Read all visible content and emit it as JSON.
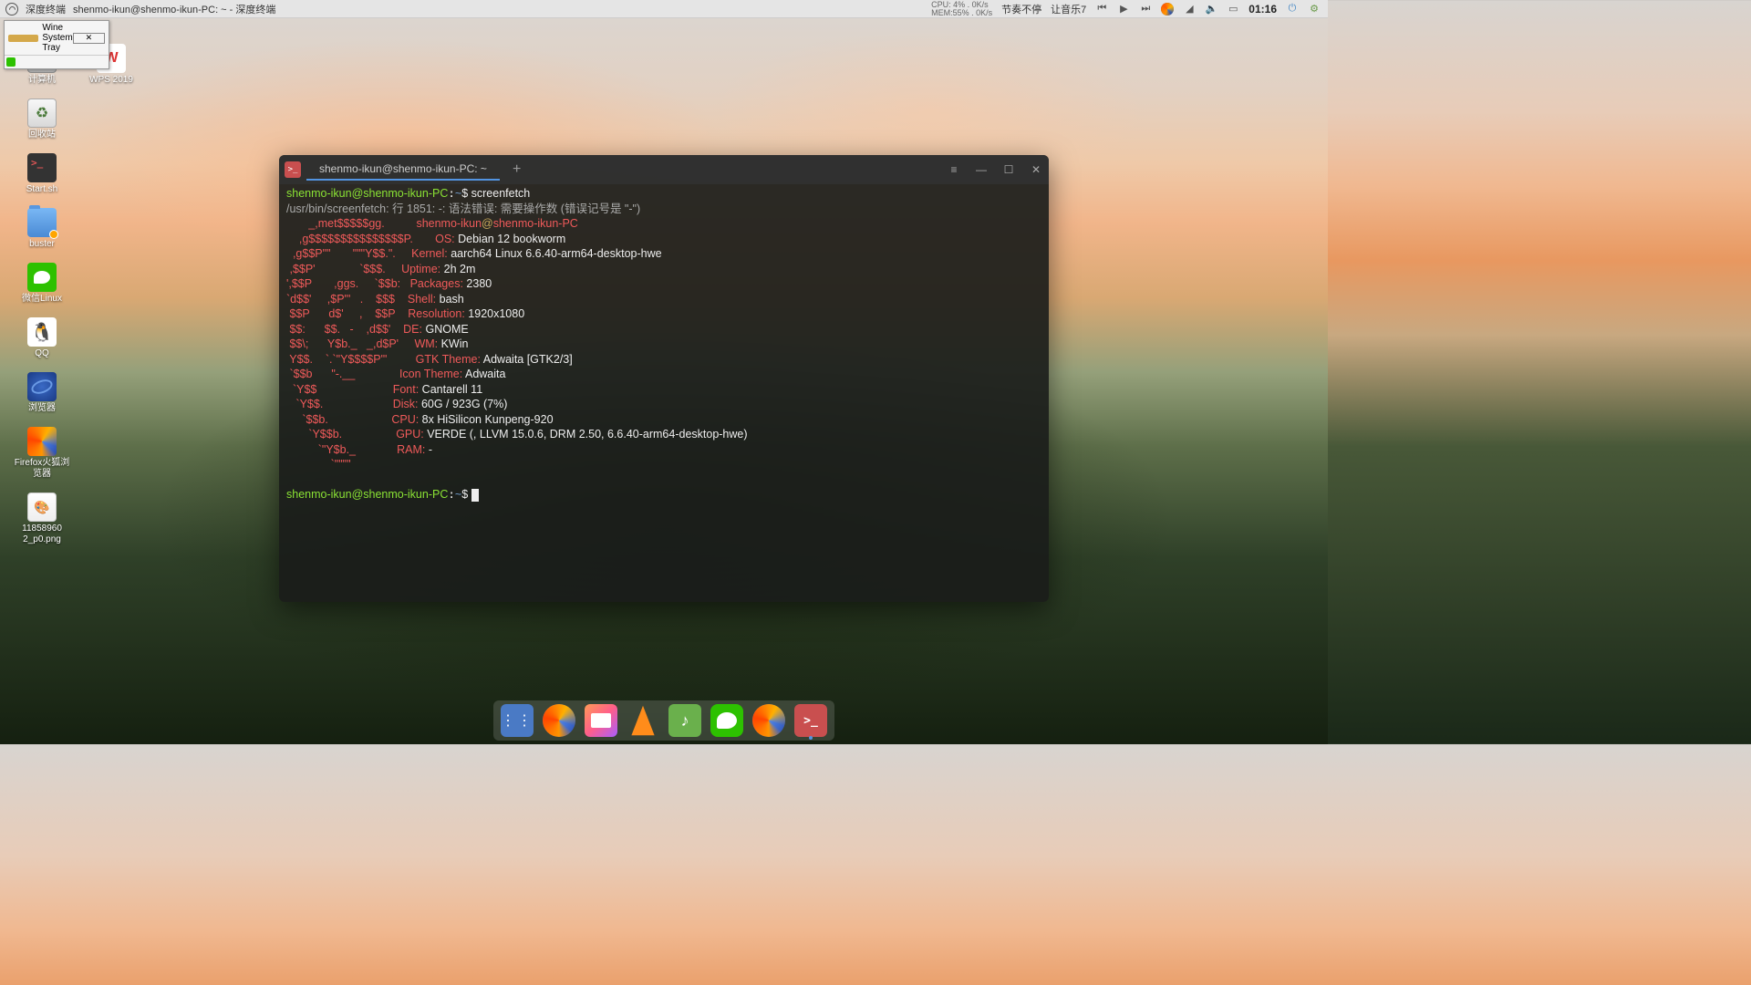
{
  "top_panel": {
    "app_name": "深度终端",
    "window_title": "shenmo-ikun@shenmo-ikun-PC: ~ - 深度终端",
    "stats_line1": "CPU: 4% .  0K/s",
    "stats_line2": "MEM:55% .  0K/s",
    "txt1": "节奏不停",
    "txt2": "让音乐7",
    "clock": "01:16"
  },
  "wine_tray": {
    "title": "Wine System Tray"
  },
  "desktop": {
    "computer": "计算机",
    "wps": "WPS 2019",
    "trash": "回收站",
    "start": "Start.sh",
    "buster": "buster",
    "wechat": "微信Linux",
    "qq": "QQ",
    "browser": "浏览器",
    "firefox": "Firefox火狐浏览器",
    "image": "11858960\n2_p0.png"
  },
  "terminal": {
    "tab_title": "shenmo-ikun@shenmo-ikun-PC: ~",
    "prompt_user": "shenmo-ikun@shenmo-ikun-PC",
    "prompt_path": "~",
    "prompt_sym": "$",
    "cmd": "screenfetch",
    "err": "/usr/bin/screenfetch: 行 1851: -: 语法错误: 需要操作数 (错误记号是 \"-\")",
    "logo": [
      "       _,met$$$$$gg.",
      "    ,g$$$$$$$$$$$$$$$P.",
      "  ,g$$P\"\"       \"\"\"Y$$.\".",
      " ,$$P'              `$$$.",
      "',$$P       ,ggs.     `$$b:",
      "`d$$'     ,$P\"'   .    $$$",
      " $$P      d$'     ,    $$P",
      " $$:      $$.   -    ,d$$'",
      " $$\\;      Y$b._   _,d$P'",
      " Y$$.    `.`\"Y$$$$P\"'",
      " `$$b      \"-.__",
      "  `Y$$",
      "   `Y$$.",
      "     `$$b.",
      "       `Y$$b.",
      "          `\"Y$b._",
      "              `\"\"\"\""
    ],
    "info_user": "shenmo-ikun",
    "info_at": "@",
    "info_host": "shenmo-ikun-PC",
    "lbl_os": "OS:",
    "val_os": " Debian 12 bookworm",
    "lbl_kernel": "Kernel:",
    "val_kernel": " aarch64 Linux 6.6.40-arm64-desktop-hwe",
    "lbl_uptime": "Uptime:",
    "val_uptime": " 2h 2m",
    "lbl_packages": "Packages:",
    "val_packages": " 2380",
    "lbl_shell": "Shell:",
    "val_shell": " bash",
    "lbl_res": "Resolution:",
    "val_res": " 1920x1080",
    "lbl_de": "DE:",
    "val_de": " GNOME",
    "lbl_wm": "WM:",
    "val_wm": " KWin",
    "lbl_gtk": "GTK Theme:",
    "val_gtk": " Adwaita [GTK2/3]",
    "lbl_icon": "Icon Theme:",
    "val_icon": " Adwaita",
    "lbl_font": "Font:",
    "val_font": " Cantarell 11",
    "lbl_disk": "Disk:",
    "val_disk": " 60G / 923G (7%)",
    "lbl_cpu": "CPU:",
    "val_cpu": " 8x HiSilicon Kunpeng-920",
    "lbl_gpu": "GPU:",
    "val_gpu": " VERDE (, LLVM 15.0.6, DRM 2.50, 6.6.40-arm64-desktop-hwe)",
    "lbl_ram": "RAM:",
    "val_ram": " -"
  }
}
